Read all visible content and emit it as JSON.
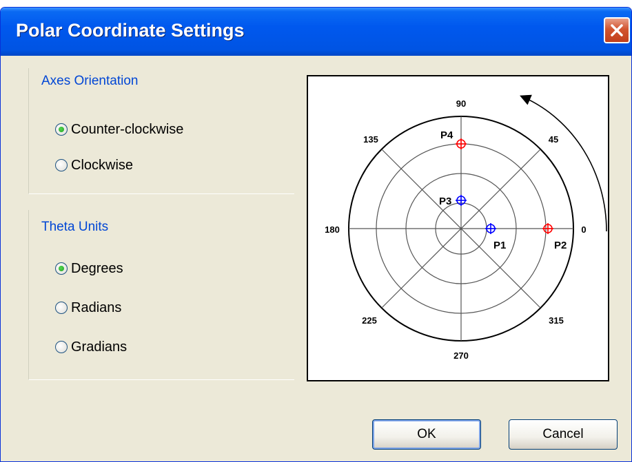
{
  "window": {
    "title": "Polar Coordinate Settings"
  },
  "axes_orientation": {
    "title": "Axes Orientation",
    "options": [
      {
        "label": "Counter-clockwise",
        "checked": true
      },
      {
        "label": "Clockwise",
        "checked": false
      }
    ]
  },
  "theta_units": {
    "title": "Theta Units",
    "options": [
      {
        "label": "Degrees",
        "checked": true
      },
      {
        "label": "Radians",
        "checked": false
      },
      {
        "label": "Gradians",
        "checked": false
      }
    ]
  },
  "preview": {
    "angle_labels": [
      "90",
      "45",
      "0",
      "315",
      "270",
      "225",
      "180",
      "135"
    ],
    "points": [
      {
        "label": "P1",
        "color": "#0000ff"
      },
      {
        "label": "P2",
        "color": "#ff0000"
      },
      {
        "label": "P3",
        "color": "#0000ff"
      },
      {
        "label": "P4",
        "color": "#ff0000"
      }
    ]
  },
  "buttons": {
    "ok": "OK",
    "cancel": "Cancel"
  },
  "colors": {
    "titlebar": "#0054e3",
    "group_title": "#0046d5",
    "dialog_bg": "#ece9d8"
  }
}
